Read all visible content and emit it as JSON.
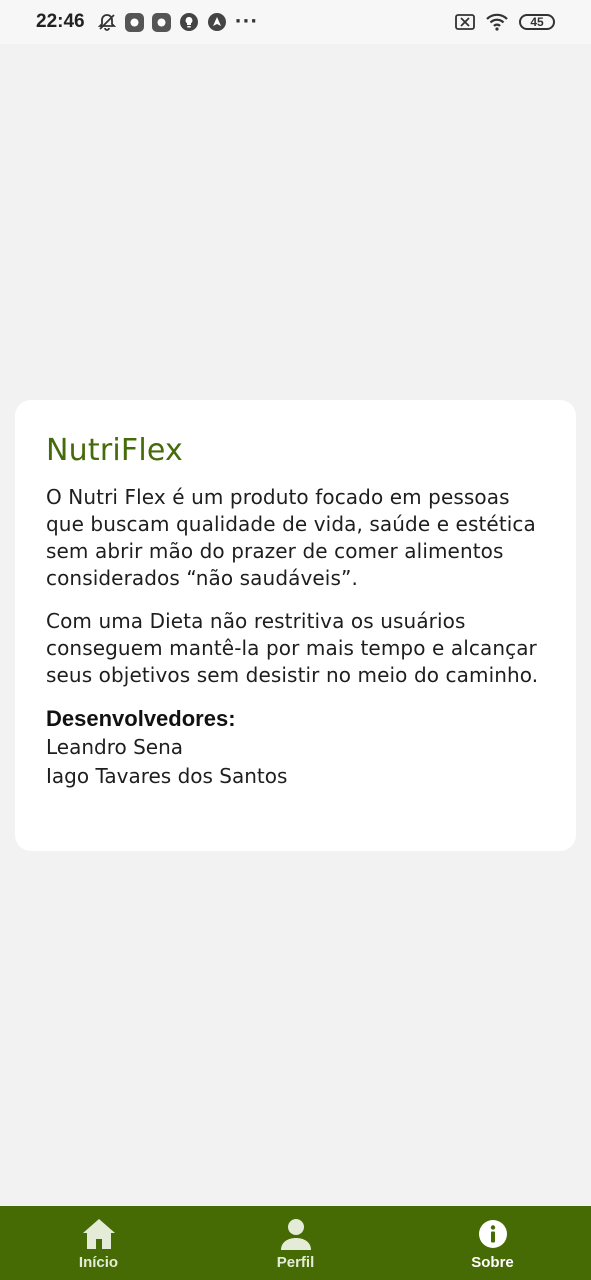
{
  "status_bar": {
    "time": "22:46",
    "battery": "45",
    "icons": [
      "muted-bell-icon",
      "app-notification-icon",
      "app-notification-icon",
      "lightbulb-icon",
      "navigation-icon",
      "more-dots-icon",
      "sim-disabled-icon",
      "wifi-icon",
      "battery-icon"
    ]
  },
  "about": {
    "title": "NutriFlex",
    "paragraph_1": "O Nutri Flex é um produto focado em pessoas que buscam qualidade de vida, saúde e estética sem abrir mão do prazer de comer alimentos considerados “não saudáveis”.",
    "paragraph_2": "Com uma Dieta não restritiva os usuários conseguem mantê-la por mais tempo e alcançar seus objetivos sem desistir no meio do caminho.",
    "developers_heading": "Desenvolvedores:",
    "developers": [
      "Leandro Sena",
      "Iago Tavares dos Santos"
    ]
  },
  "bottom_nav": {
    "items": [
      {
        "label": "Início",
        "icon": "home-icon",
        "active": false
      },
      {
        "label": "Perfil",
        "icon": "user-icon",
        "active": false
      },
      {
        "label": "Sobre",
        "icon": "info-icon",
        "active": true
      }
    ]
  },
  "colors": {
    "brand_green": "#476b04",
    "title_green": "#466b0a",
    "background": "#f2f2f2",
    "card": "#ffffff"
  }
}
